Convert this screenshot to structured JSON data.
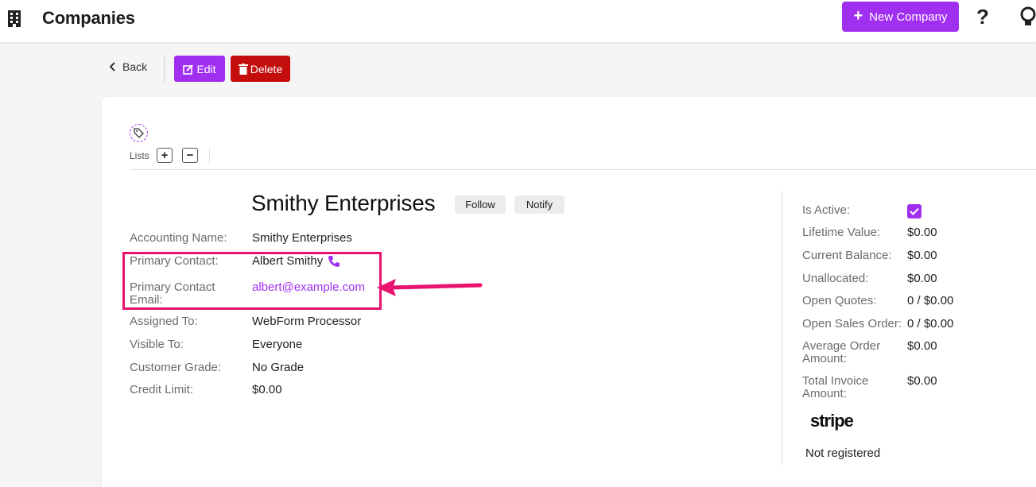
{
  "header": {
    "title": "Companies",
    "new_button_label": "New Company"
  },
  "actions": {
    "back_label": "Back",
    "edit_label": "Edit",
    "delete_label": "Delete"
  },
  "lists": {
    "label": "Lists",
    "add_symbol": "+",
    "remove_symbol": "−"
  },
  "company": {
    "name": "Smithy Enterprises",
    "follow_label": "Follow",
    "notify_label": "Notify"
  },
  "details": [
    {
      "label": "Accounting Name:",
      "value": "Smithy Enterprises"
    },
    {
      "label": "Primary Contact:",
      "value": "Albert Smithy"
    },
    {
      "label": "Primary Contact Email:",
      "value": "albert@example.com"
    },
    {
      "label": "Assigned To:",
      "value": "WebForm Processor"
    },
    {
      "label": "Visible To:",
      "value": "Everyone"
    },
    {
      "label": "Customer Grade:",
      "value": "No Grade"
    },
    {
      "label": "Credit Limit:",
      "value": "$0.00"
    }
  ],
  "summary": [
    {
      "label": "Is Active:",
      "value": ""
    },
    {
      "label": "Lifetime Value:",
      "value": "$0.00"
    },
    {
      "label": "Current Balance:",
      "value": "$0.00"
    },
    {
      "label": "Unallocated:",
      "value": "$0.00"
    },
    {
      "label": "Open Quotes:",
      "value": "0 / $0.00"
    },
    {
      "label": "Open Sales Order:",
      "value": "0 / $0.00"
    },
    {
      "label": "Average Order Amount:",
      "value": "$0.00"
    },
    {
      "label": "Total Invoice Amount:",
      "value": "$0.00"
    }
  ],
  "is_active": true,
  "stripe": {
    "logo_text": "stripe",
    "status": "Not registered"
  },
  "colors": {
    "accent": "#a12ff0",
    "danger": "#c40d0d",
    "highlight": "#e8136f"
  }
}
